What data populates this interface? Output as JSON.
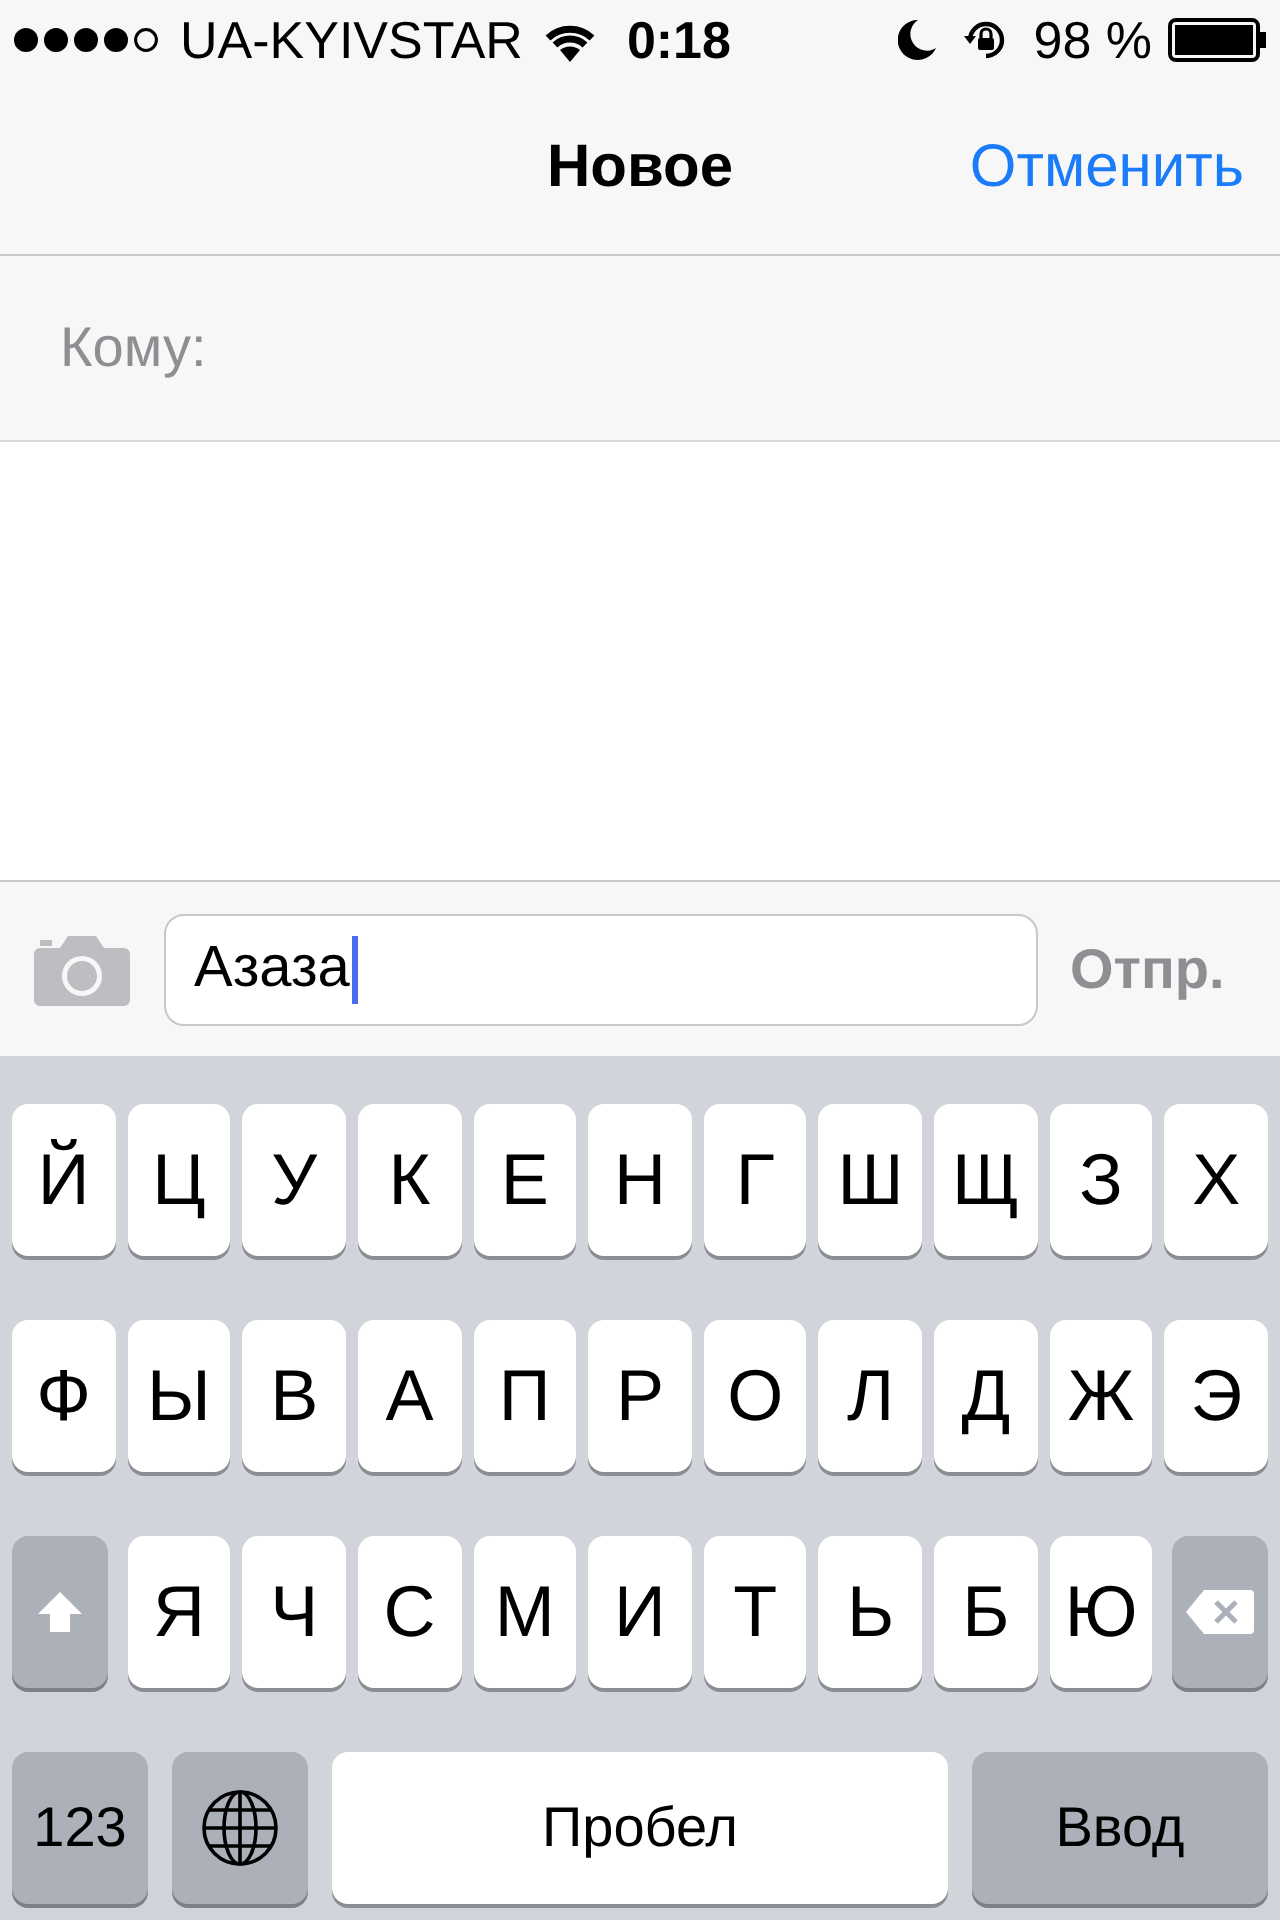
{
  "status_bar": {
    "carrier": "UA-KYIVSTAR",
    "time": "0:18",
    "battery": "98 %"
  },
  "nav_bar": {
    "title": "Новое",
    "cancel": "Отменить"
  },
  "recipient": {
    "label": "Кому:"
  },
  "compose": {
    "value": "Азаза",
    "send": "Отпр.",
    "send_disabled": true
  },
  "keyboard": {
    "rows": [
      [
        {
          "kind": "letter",
          "label": "Й"
        },
        {
          "kind": "letter",
          "label": "Ц"
        },
        {
          "kind": "letter",
          "label": "У"
        },
        {
          "kind": "letter",
          "label": "К"
        },
        {
          "kind": "letter",
          "label": "Е"
        },
        {
          "kind": "letter",
          "label": "Н"
        },
        {
          "kind": "letter",
          "label": "Г"
        },
        {
          "kind": "letter",
          "label": "Ш"
        },
        {
          "kind": "letter",
          "label": "Щ"
        },
        {
          "kind": "letter",
          "label": "З"
        },
        {
          "kind": "letter",
          "label": "Х"
        }
      ],
      [
        {
          "kind": "letter",
          "label": "Ф"
        },
        {
          "kind": "letter",
          "label": "Ы"
        },
        {
          "kind": "letter",
          "label": "В"
        },
        {
          "kind": "letter",
          "label": "А"
        },
        {
          "kind": "letter",
          "label": "П"
        },
        {
          "kind": "letter",
          "label": "Р"
        },
        {
          "kind": "letter",
          "label": "О"
        },
        {
          "kind": "letter",
          "label": "Л"
        },
        {
          "kind": "letter",
          "label": "Д"
        },
        {
          "kind": "letter",
          "label": "Ж"
        },
        {
          "kind": "letter",
          "label": "Э"
        }
      ],
      [
        {
          "kind": "shift"
        },
        {
          "kind": "letter",
          "label": "Я"
        },
        {
          "kind": "letter",
          "label": "Ч"
        },
        {
          "kind": "letter",
          "label": "С"
        },
        {
          "kind": "letter",
          "label": "М"
        },
        {
          "kind": "letter",
          "label": "И"
        },
        {
          "kind": "letter",
          "label": "Т"
        },
        {
          "kind": "letter",
          "label": "Ь"
        },
        {
          "kind": "letter",
          "label": "Б"
        },
        {
          "kind": "letter",
          "label": "Ю"
        },
        {
          "kind": "delete"
        }
      ]
    ],
    "bottom_bar": {
      "keys": [
        {
          "kind": "numbers",
          "label": "123"
        },
        {
          "kind": "globe"
        },
        {
          "kind": "space",
          "label": "Пробел"
        },
        {
          "kind": "return",
          "label": "Ввод"
        }
      ]
    }
  }
}
